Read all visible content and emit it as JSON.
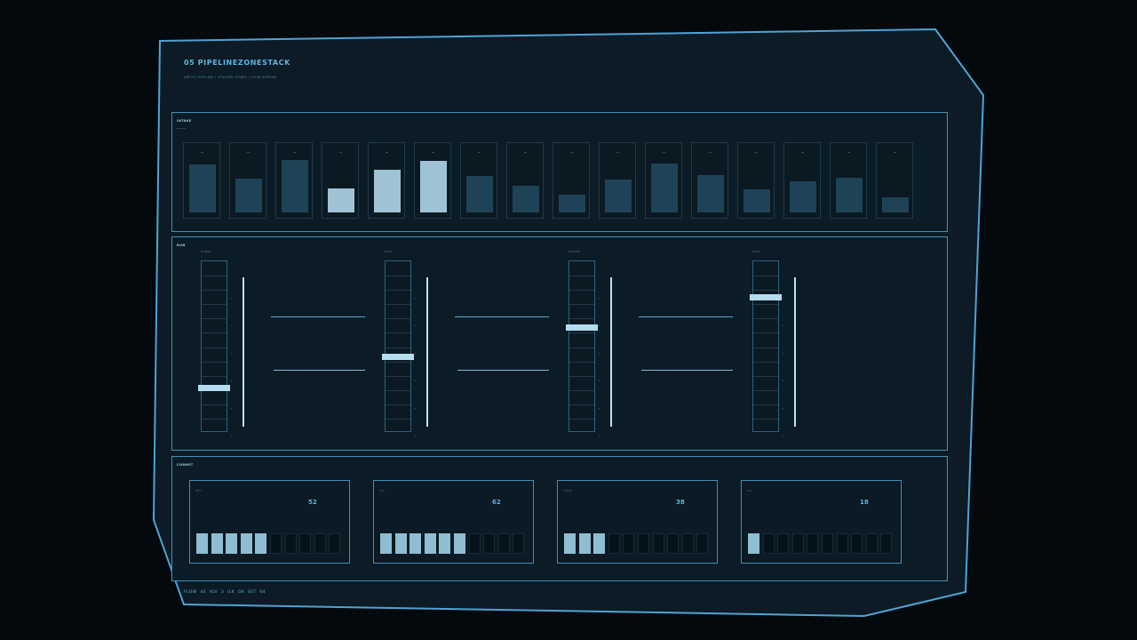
{
  "header": {
    "title": "05 PIPELINEZONESTACK",
    "subtitle": "ARCTIC PIPELINE / STACKED ZONES / FLOW STREAM"
  },
  "intake": {
    "label": "INTAKE",
    "bars": [
      {
        "level": 0.75,
        "highlight": false
      },
      {
        "level": 0.53,
        "highlight": false
      },
      {
        "level": 0.82,
        "highlight": false
      },
      {
        "level": 0.38,
        "highlight": true
      },
      {
        "level": 0.66,
        "highlight": true
      },
      {
        "level": 0.81,
        "highlight": true
      },
      {
        "level": 0.57,
        "highlight": false
      },
      {
        "level": 0.41,
        "highlight": false
      },
      {
        "level": 0.28,
        "highlight": false
      },
      {
        "level": 0.52,
        "highlight": false
      },
      {
        "level": 0.76,
        "highlight": false
      },
      {
        "level": 0.59,
        "highlight": false
      },
      {
        "level": 0.36,
        "highlight": false
      },
      {
        "level": 0.49,
        "highlight": false
      },
      {
        "level": 0.54,
        "highlight": false
      },
      {
        "level": 0.24,
        "highlight": false
      }
    ]
  },
  "run": {
    "label": "RUN",
    "sliders": [
      {
        "label": "CHNNL",
        "level": 0.26
      },
      {
        "label": "FLTR",
        "level": 0.44
      },
      {
        "label": "BUFFER",
        "level": 0.61
      },
      {
        "label": "GATE",
        "level": 0.79
      }
    ]
  },
  "commit": {
    "label": "COMMIT",
    "cards": [
      {
        "label": "SET",
        "value": "52",
        "filled": 5,
        "total": 10
      },
      {
        "label": "VLV",
        "value": "62",
        "filled": 6,
        "total": 10
      },
      {
        "label": "FLOW",
        "value": "38",
        "filled": 3,
        "total": 10
      },
      {
        "label": "ILK",
        "value": "18",
        "filled": 1,
        "total": 10
      }
    ]
  },
  "status": "FLOW 44 VLV 3 ILK OK SET 04",
  "colors": {
    "frame": "#4fa3d6",
    "accent": "#5db5e0",
    "bar_fill": "#1f4356",
    "bar_highlight": "#9fc3d4",
    "panel_bg": "#0c1c26"
  }
}
